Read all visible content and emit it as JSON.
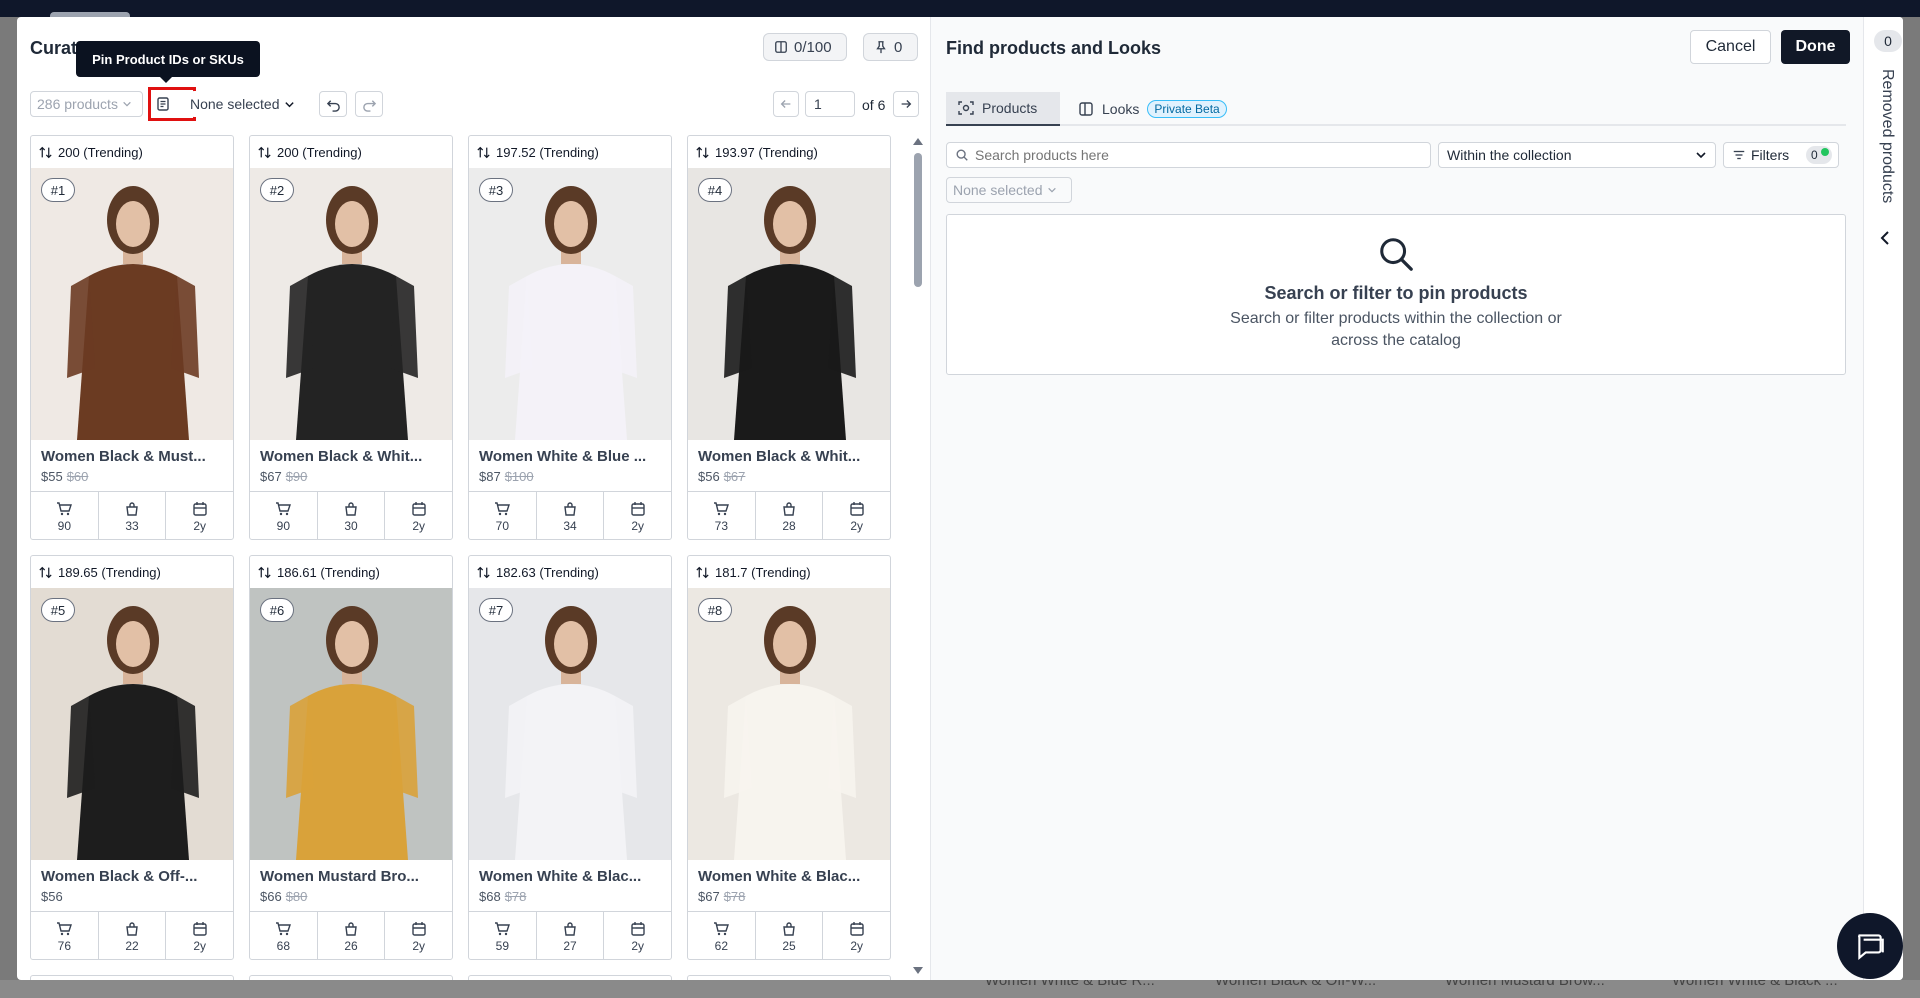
{
  "background": {
    "bottom_product_names": [
      "Women White & Blue R...",
      "Women Black & Off-W...",
      "Women Mustard Brow...",
      "Women White & Black ..."
    ]
  },
  "header": {
    "title": "Curat",
    "count_pill": "0/100",
    "pin_pill": "0"
  },
  "tooltip": "Pin Product IDs or SKUs",
  "toolbar": {
    "products_count": "286 products",
    "selection": "None selected",
    "page": "1",
    "of_pages": "of 6"
  },
  "products": [
    {
      "score": "200 (Trending)",
      "rank": "#1",
      "name": "Women Black & Must...",
      "price": "$55",
      "original_price": "$60",
      "orders": "90",
      "views": "33",
      "age": "2y",
      "palette": [
        "#efe9e4",
        "#6b3b22",
        "#c9a060"
      ]
    },
    {
      "score": "200 (Trending)",
      "rank": "#2",
      "name": "Women Black & Whit...",
      "price": "$67",
      "original_price": "$90",
      "orders": "90",
      "views": "30",
      "age": "2y",
      "palette": [
        "#eeeae6",
        "#232323",
        "#8b8b8b"
      ]
    },
    {
      "score": "197.52 (Trending)",
      "rank": "#3",
      "name": "Women White & Blue ...",
      "price": "$87",
      "original_price": "$100",
      "orders": "70",
      "views": "34",
      "age": "2y",
      "palette": [
        "#ececec",
        "#f4f2f8",
        "#5a1420"
      ]
    },
    {
      "score": "193.97 (Trending)",
      "rank": "#4",
      "name": "Women Black & Whit...",
      "price": "$56",
      "original_price": "$67",
      "orders": "73",
      "views": "28",
      "age": "2y",
      "palette": [
        "#e8e6e3",
        "#1a1a1a",
        "#3a5a88"
      ]
    },
    {
      "score": "189.65 (Trending)",
      "rank": "#5",
      "name": "Women Black & Off-...",
      "price": "$56",
      "original_price": "",
      "orders": "76",
      "views": "22",
      "age": "2y",
      "palette": [
        "#e3dcd3",
        "#1d1d1d",
        "#4a4a4a"
      ]
    },
    {
      "score": "186.61 (Trending)",
      "rank": "#6",
      "name": "Women Mustard Bro...",
      "price": "$66",
      "original_price": "$80",
      "orders": "68",
      "views": "26",
      "age": "2y",
      "palette": [
        "#bfc3c1",
        "#d9a23a",
        "#6a4a30"
      ]
    },
    {
      "score": "182.63 (Trending)",
      "rank": "#7",
      "name": "Women White & Blac...",
      "price": "$68",
      "original_price": "$78",
      "orders": "59",
      "views": "27",
      "age": "2y",
      "palette": [
        "#e6e7ea",
        "#f3f3f6",
        "#1c2233"
      ]
    },
    {
      "score": "181.7 (Trending)",
      "rank": "#8",
      "name": "Women White & Blac...",
      "price": "$67",
      "original_price": "$78",
      "orders": "62",
      "views": "25",
      "age": "2y",
      "palette": [
        "#ece8e2",
        "#f7f4ee",
        "#1a1a1a"
      ]
    }
  ],
  "right_panel": {
    "title": "Find products and Looks",
    "cancel_label": "Cancel",
    "done_label": "Done",
    "tabs": [
      {
        "label": "Products",
        "icon": "scan-icon"
      },
      {
        "label": "Looks",
        "icon": "book-icon",
        "badge": "Private Beta"
      }
    ],
    "search_placeholder": "Search products here",
    "scope": "Within the collection",
    "filters_label": "Filters",
    "filters_count": "0",
    "selection": "None selected",
    "empty_title": "Search or filter to pin products",
    "empty_description": "Search or filter products within the collection or across the catalog"
  },
  "side_rail": {
    "removed_count": "0",
    "removed_label": "Removed products"
  },
  "colors": {
    "primary": "#111827",
    "highlight": "#e01010",
    "beta_badge": "#0369a1",
    "status_dot": "#22c55e"
  }
}
